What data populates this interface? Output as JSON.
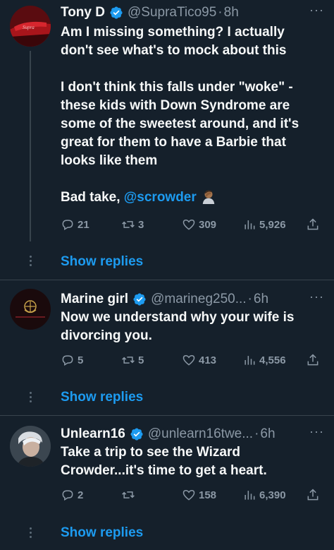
{
  "tweets": [
    {
      "name": "Tony D",
      "handle": "@SupraTico95",
      "time": "8h",
      "lines": [
        "Am I missing something? I actually",
        "don't see what's to mock about this",
        "",
        "I don't think this falls under \"woke\" -",
        "these kids with Down Syndrome are",
        "some of the sweetest around, and it's",
        "great for them to have a Barbie that",
        "looks like them",
        ""
      ],
      "last_line_prefix": "Bad take, ",
      "mention": "@scrowder",
      "emoji_icon": "person-facepalming-icon",
      "replies": "21",
      "retweets": "3",
      "likes": "309",
      "views": "5,926",
      "show_replies": "Show replies"
    },
    {
      "name": "Marine girl",
      "handle": "@marineg250...",
      "time": "6h",
      "lines": [
        "Now we understand why your wife is",
        "divorcing you."
      ],
      "replies": "5",
      "retweets": "5",
      "likes": "413",
      "views": "4,556",
      "show_replies": "Show replies"
    },
    {
      "name": "Unlearn16",
      "handle": "@unlearn16twe...",
      "time": "6h",
      "lines": [
        "Take a trip to see the Wizard",
        "Crowder...it's time to get a heart."
      ],
      "replies": "2",
      "retweets": "",
      "likes": "158",
      "views": "6,390",
      "show_replies": "Show replies"
    }
  ],
  "colors": {
    "background": "#15202b",
    "text": "#f7f9f9",
    "secondary": "#8b98a5",
    "accent": "#1d9bf0",
    "divider": "#38444d"
  },
  "more_label": "···",
  "dot": "·"
}
